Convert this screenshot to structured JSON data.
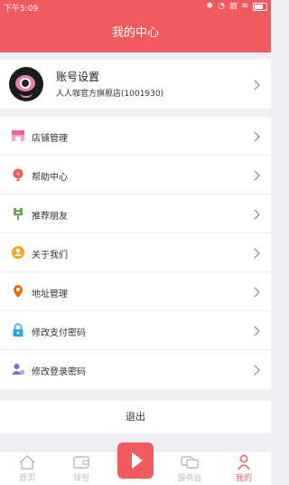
{
  "status": {
    "time": "下午5:09"
  },
  "header": {
    "title": "我的中心"
  },
  "profile": {
    "title": "账号设置",
    "subtitle": "人人咖官方旗舰店(1001930)"
  },
  "menu": [
    {
      "label": "店铺管理",
      "icon": "store-icon"
    },
    {
      "label": "帮助中心",
      "icon": "help-icon"
    },
    {
      "label": "推荐朋友",
      "icon": "recommend-icon"
    },
    {
      "label": "关于我们",
      "icon": "about-icon"
    },
    {
      "label": "地址管理",
      "icon": "location-icon"
    },
    {
      "label": "修改支付密码",
      "icon": "lock-icon"
    },
    {
      "label": "修改登录密码",
      "icon": "user-lock-icon"
    }
  ],
  "logout": {
    "label": "退出"
  },
  "tabs": [
    {
      "label": "首页"
    },
    {
      "label": "钱包"
    },
    {
      "label": ""
    },
    {
      "label": "服务台"
    },
    {
      "label": "我的"
    }
  ],
  "colors": {
    "accent": "#f25b5d"
  }
}
